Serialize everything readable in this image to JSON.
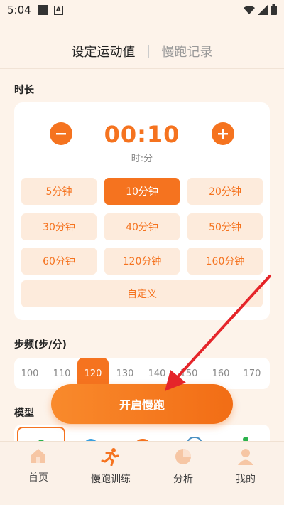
{
  "status": {
    "time": "5:04",
    "a_icon": "A"
  },
  "tabs": [
    {
      "label": "设定运动值",
      "active": true
    },
    {
      "label": "慢跑记录",
      "active": false
    }
  ],
  "duration": {
    "title": "时长",
    "display": "00:10",
    "unit": "时:分",
    "options": [
      "5分钟",
      "10分钟",
      "20分钟",
      "30分钟",
      "40分钟",
      "50分钟",
      "60分钟",
      "120分钟",
      "160分钟"
    ],
    "selected": "10分钟",
    "custom": "自定义"
  },
  "cadence": {
    "title": "步频(步/分)",
    "values": [
      "100",
      "110",
      "120",
      "130",
      "140",
      "150",
      "160",
      "170"
    ],
    "selected": "120"
  },
  "model": {
    "title": "模型"
  },
  "start_button": "开启慢跑",
  "nav": [
    {
      "label": "首页",
      "icon": "home-icon"
    },
    {
      "label": "慢跑训练",
      "icon": "running-icon"
    },
    {
      "label": "分析",
      "icon": "pie-chart-icon"
    },
    {
      "label": "我的",
      "icon": "person-icon"
    }
  ],
  "colors": {
    "accent": "#f5731f",
    "annotation": "#e5252a"
  }
}
